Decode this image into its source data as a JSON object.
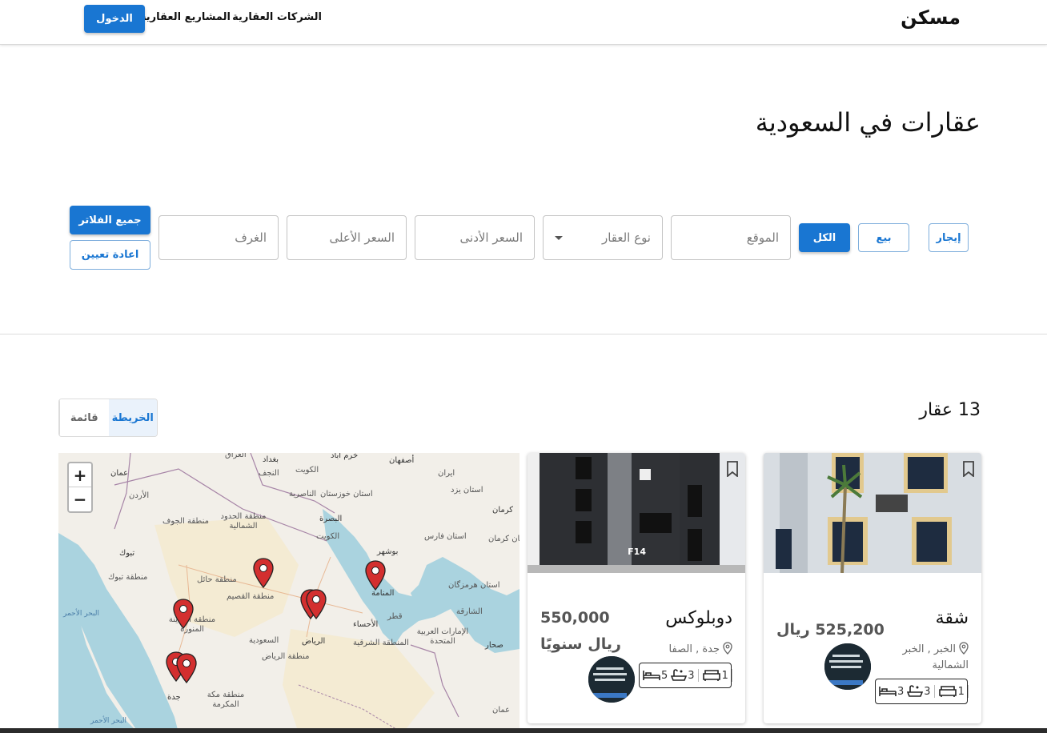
{
  "header": {
    "logo": "مسكن",
    "nav": [
      "الشركات العقارية",
      "المشاريع العقارية"
    ],
    "login": "الدخول"
  },
  "page_title": "عقارات في السعودية",
  "filters": {
    "listing_types": [
      "إيجار",
      "بيع",
      "الكل"
    ],
    "location_placeholder": "الموقع",
    "property_type_placeholder": "نوع العقار",
    "min_price_placeholder": "السعر الأدنى",
    "max_price_placeholder": "السعر الأعلى",
    "rooms_placeholder": "الغرف",
    "all_filters": "جميع الفلاتر",
    "reset": "اعادة تعيين"
  },
  "results": {
    "count": "13 عقار",
    "view_toggle": {
      "list": "قائمة",
      "map": "الخريطة",
      "active": "map"
    }
  },
  "map": {
    "zoom_in": "+",
    "zoom_out": "−",
    "labels": {
      "iraq": "العراق",
      "baghdad": "بغداد",
      "kuwait": "الكويت",
      "khorramabad": "خرم آباد",
      "isfahan": "أصفهان",
      "amman": "عمان",
      "jordan": "الأردن",
      "najaf": "النجف",
      "nasiriyah": "الناصرية",
      "khuzestan": "استان خوزستان",
      "iran": "ایران",
      "yazd": "استان يزد",
      "kerman": "کرمان",
      "kerman_prov": "استان کرمان",
      "jouf": "منطقة الجوف",
      "northern_borders": "منطقة الحدود الشمالية",
      "basra": "البصرة",
      "kuwait2": "الكويت",
      "fars": "استان فارس",
      "bushehr": "بوشهر",
      "tabuk": "تبوك",
      "tabuk_region": "منطقة تبوك",
      "hail": "منطقة حائل",
      "qassim": "منطقة القصيم",
      "manama": "المنامة",
      "hormozgan": "استان هرمزگان",
      "red_sea": "البحر الأحمر",
      "madinah": "منطقة المدينة المنورة",
      "ahsa": "الأحساء",
      "qatar": "قطر",
      "sharjah": "الشارقة",
      "saudi": "السعودية",
      "riyadh": "الرياض",
      "eastern": "المنطقة الشرقية",
      "uae": "الإمارات العربية المتحدة",
      "sohar": "صحار",
      "riyadh_region": "منطقة الرياض",
      "jeddah": "جدة",
      "makkah": "منطقة مكة المكرمة",
      "oman": "عمان",
      "red_sea2": "البحر الأحمر"
    }
  },
  "listings": [
    {
      "title": "شقة",
      "price": "525,200 ريال",
      "price_unit": "",
      "location": "الخبر , الخبر الشمالية",
      "features": {
        "beds": "3",
        "baths": "3",
        "living": "1"
      }
    },
    {
      "title": "دوبلوكس",
      "price": "550,000",
      "price_unit": "ريال سنويًا",
      "location": "جدة , الصفا",
      "features": {
        "beds": "5",
        "baths": "3",
        "living": "1"
      }
    }
  ],
  "colors": {
    "primary": "#1976d2",
    "pin": "#d32f2f",
    "sea": "#aad3df",
    "land": "#f2efe9"
  }
}
